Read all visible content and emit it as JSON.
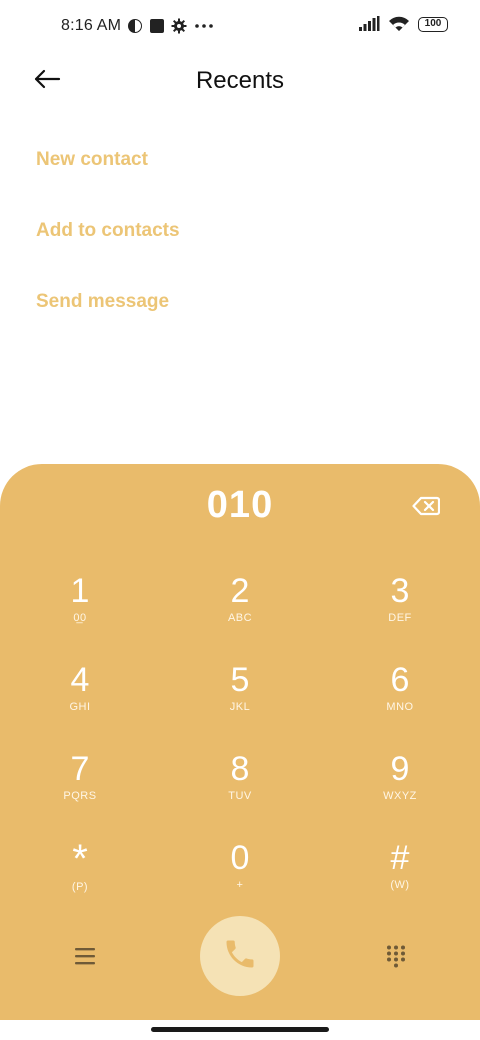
{
  "status_bar": {
    "time": "8:16 AM",
    "battery": "100",
    "icons": [
      "pie-icon",
      "square-icon",
      "gear-icon",
      "more-icon",
      "signal-icon",
      "wifi-icon",
      "battery-icon"
    ]
  },
  "header": {
    "title": "Recents",
    "back_icon": "arrow-left-icon"
  },
  "actions": [
    {
      "label": "New contact"
    },
    {
      "label": "Add to contacts"
    },
    {
      "label": "Send message"
    }
  ],
  "dialer": {
    "number": "010",
    "backspace_icon": "backspace-icon",
    "keys": [
      {
        "digit": "1",
        "letters": "0̲0"
      },
      {
        "digit": "2",
        "letters": "ABC"
      },
      {
        "digit": "3",
        "letters": "DEF"
      },
      {
        "digit": "4",
        "letters": "GHI"
      },
      {
        "digit": "5",
        "letters": "JKL"
      },
      {
        "digit": "6",
        "letters": "MNO"
      },
      {
        "digit": "7",
        "letters": "PQRS"
      },
      {
        "digit": "8",
        "letters": "TUV"
      },
      {
        "digit": "9",
        "letters": "WXYZ"
      },
      {
        "digit": "*",
        "letters": "(P)"
      },
      {
        "digit": "0",
        "letters": "+"
      },
      {
        "digit": "#",
        "letters": "(W)"
      }
    ],
    "bottom_icons": [
      "menu-icon",
      "phone-icon",
      "dialpad-icon"
    ]
  },
  "colors": {
    "accent": "#e9bb6b",
    "accent_light": "#ecc576",
    "call_button": "#f5e2b5",
    "text_dark": "#111111"
  }
}
